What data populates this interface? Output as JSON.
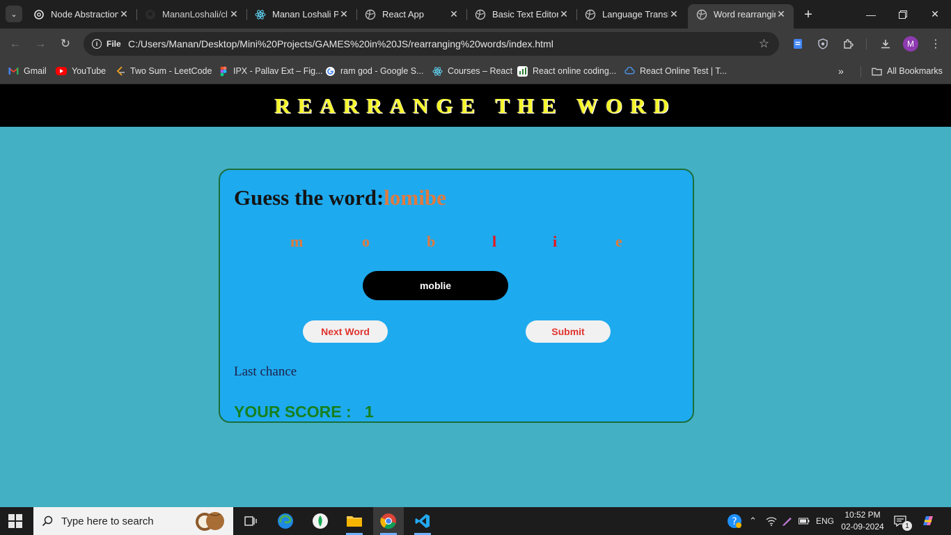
{
  "browser": {
    "tabs": [
      {
        "title": "Node Abstraction",
        "icon": "openai-icon"
      },
      {
        "title": "MananLoshali/cl",
        "icon": "github-icon"
      },
      {
        "title": "Manan Loshali P",
        "icon": "react-icon"
      },
      {
        "title": "React App",
        "icon": "globe-icon"
      },
      {
        "title": "Basic Text Editor",
        "icon": "globe-icon"
      },
      {
        "title": "Language Transl",
        "icon": "globe-icon"
      },
      {
        "title": "Word rearranging",
        "icon": "globe-icon",
        "active": true
      }
    ],
    "address": {
      "chip_label": "File",
      "url": "C:/Users/Manan/Desktop/Mini%20Projects/GAMES%20in%20JS/rearranging%20words/index.html"
    },
    "profile_initial": "M",
    "bookmarks": [
      {
        "label": "Gmail",
        "icon": "gmail-icon"
      },
      {
        "label": "YouTube",
        "icon": "youtube-icon"
      },
      {
        "label": "Two Sum - LeetCode",
        "icon": "leetcode-icon"
      },
      {
        "label": "IPX - Pallav Ext – Fig...",
        "icon": "figma-icon"
      },
      {
        "label": "ram god - Google S...",
        "icon": "google-icon"
      },
      {
        "label": "Courses – React",
        "icon": "react-icon"
      },
      {
        "label": "React online coding...",
        "icon": "chart-icon"
      },
      {
        "label": "React Online Test | T...",
        "icon": "cloud-icon"
      }
    ],
    "all_bookmarks_label": "All Bookmarks"
  },
  "game": {
    "banner_title": "REARRANGE THE WORD",
    "guess_label": "Guess the word:",
    "scrambled_word": "lomibe",
    "letters": [
      {
        "char": "m",
        "color": "#e07a3f"
      },
      {
        "char": "o",
        "color": "#e07a3f"
      },
      {
        "char": "b",
        "color": "#e07a3f"
      },
      {
        "char": "l",
        "color": "#e8131b"
      },
      {
        "char": "i",
        "color": "#e8131b"
      },
      {
        "char": "e",
        "color": "#e07a3f"
      }
    ],
    "answer_value": "moblie",
    "next_word_label": "Next Word",
    "submit_label": "Submit",
    "message": "Last chance",
    "score_label": "YOUR SCORE :   1"
  },
  "taskbar": {
    "search_placeholder": "Type here to search",
    "language": "ENG",
    "time": "10:52 PM",
    "date": "02-09-2024",
    "notification_count": "1"
  }
}
